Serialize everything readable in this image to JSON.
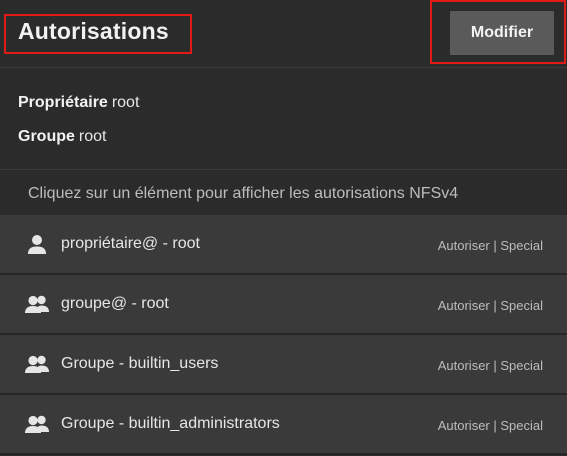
{
  "header": {
    "title": "Autorisations",
    "modify_label": "Modifier"
  },
  "owner": {
    "owner_label": "Propriétaire",
    "owner_value": "root",
    "group_label": "Groupe",
    "group_value": "root"
  },
  "hint": "Cliquez sur un élément pour afficher les autorisations NFSv4",
  "entries": [
    {
      "icon": "user-icon",
      "name": "propriétaire@ - root",
      "permission": "Autoriser | Special"
    },
    {
      "icon": "group-icon",
      "name": "groupe@ - root",
      "permission": "Autoriser | Special"
    },
    {
      "icon": "group-icon",
      "name": "Groupe - builtin_users",
      "permission": "Autoriser | Special"
    },
    {
      "icon": "group-icon",
      "name": "Groupe - builtin_administrators",
      "permission": "Autoriser | Special"
    }
  ],
  "colors": {
    "background": "#2b2b2b",
    "row_background": "#3a3a3a",
    "button_background": "#5a5a5a",
    "highlight_border": "#e01919"
  }
}
